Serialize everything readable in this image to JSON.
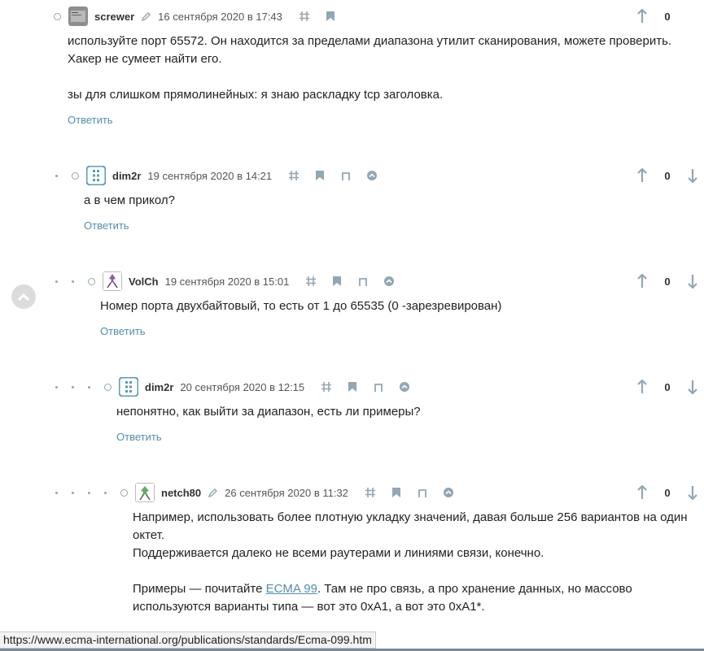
{
  "reply_label": "Ответить",
  "status_url": "https://www.ecma-international.org/publications/standards/Ecma-099.htm",
  "comments": [
    {
      "author": "screwer",
      "date": "16 сентября 2020 в 17:43",
      "votes": "0",
      "avatar": "screwer-avatar",
      "lines": [
        "используйте порт 65572. Он находится за пределами диапазона утилит сканирования, можете проверить.",
        "Хакер не сумеет найти его.",
        "",
        "зы для слишком прямолинейных: я знаю раскладку tcp заголовка."
      ]
    },
    {
      "author": "dim2r",
      "date": "19 сентября 2020 в 14:21",
      "votes": "0",
      "avatar": "dim2r-avatar",
      "lines": [
        "а в чем прикол?"
      ]
    },
    {
      "author": "VolCh",
      "date": "19 сентября 2020 в 15:01",
      "votes": "0",
      "avatar": "volch-avatar",
      "lines": [
        "Номер порта двухбайтовый, то есть от 1 до 65535 (0 -зарезревирован)"
      ]
    },
    {
      "author": "dim2r",
      "date": "20 сентября 2020 в 12:15",
      "votes": "0",
      "avatar": "dim2r-avatar",
      "lines": [
        "непонятно, как выйти за диапазон, есть ли примеры?"
      ]
    },
    {
      "author": "netch80",
      "date": "26 сентября 2020 в 11:32",
      "votes": "0",
      "avatar": "netch80-avatar",
      "lines": [
        "Например, использовать более плотную укладку значений, давая больше 256 вариантов на один",
        "октет.",
        "Поддерживается далеко не всеми раутерами и линиями связи, конечно.",
        ""
      ],
      "p2_before": "Примеры — почитайте ",
      "p2_link": "ECMA 99",
      "p2_after": ". Там не про связь, а про хранение данных, но массово",
      "p2_line2": "используются варианты типа — вот это 0xA1, а вот это 0xA1*."
    }
  ]
}
